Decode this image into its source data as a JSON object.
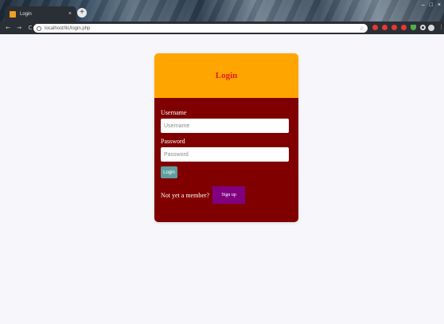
{
  "browser": {
    "tab_title": "Login",
    "tab_close": "×",
    "new_tab": "+",
    "url": "localhost/ltc/login.php",
    "window_controls": [
      "–",
      "□",
      "×"
    ]
  },
  "form": {
    "title": "Login",
    "username_label": "Username",
    "username_placeholder": "Username",
    "password_label": "Password",
    "password_placeholder": "Password",
    "login_button": "Login",
    "signup_prompt": "Not yet a member?",
    "signup_button": "Sign up"
  },
  "colors": {
    "header_bg": "#ffa500",
    "title_text": "#e01b1b",
    "body_bg": "#800000",
    "login_button_bg": "#5f9ea0",
    "signup_button_bg": "#800080"
  },
  "icons": [
    "back-icon",
    "forward-icon",
    "reload-icon",
    "info-icon",
    "star-icon",
    "extension-icon",
    "profile-icon",
    "menu-icon"
  ]
}
